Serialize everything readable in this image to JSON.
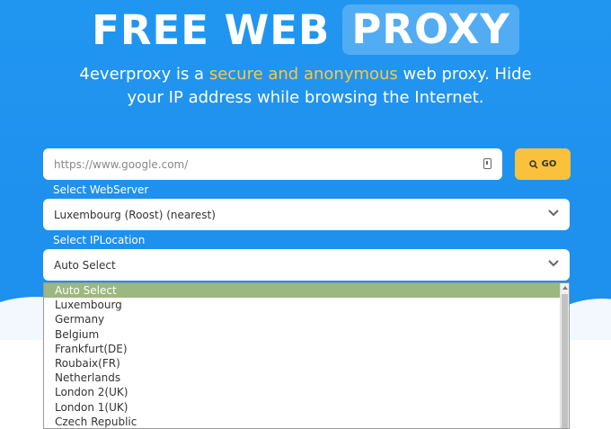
{
  "hero": {
    "title_part1": "FREE WEB",
    "title_part2": "PROXY",
    "subtitle_prefix": "4everproxy is a ",
    "subtitle_accent": "secure and anonymous",
    "subtitle_suffix_line1": " web proxy. Hide",
    "subtitle_line2": "your IP address while browsing the Internet."
  },
  "url": {
    "placeholder": "https://www.google.com/",
    "value": ""
  },
  "go_button": {
    "label": "GO"
  },
  "webserver": {
    "label": "Select WebServer",
    "selected": "Luxembourg (Roost) (nearest)"
  },
  "iplocation": {
    "label": "Select IPLocation",
    "selected": "Auto Select",
    "options": [
      "Auto Select",
      "Luxembourg",
      "Germany",
      "Belgium",
      "Frankfurt(DE)",
      "Roubaix(FR)",
      "Netherlands",
      "London 2(UK)",
      "London 1(UK)",
      "Czech Republic"
    ]
  },
  "colors": {
    "primary": "#1e90ee",
    "accent": "#f9c846",
    "button": "#f9c13c",
    "selected_option": "#9cb77f"
  }
}
